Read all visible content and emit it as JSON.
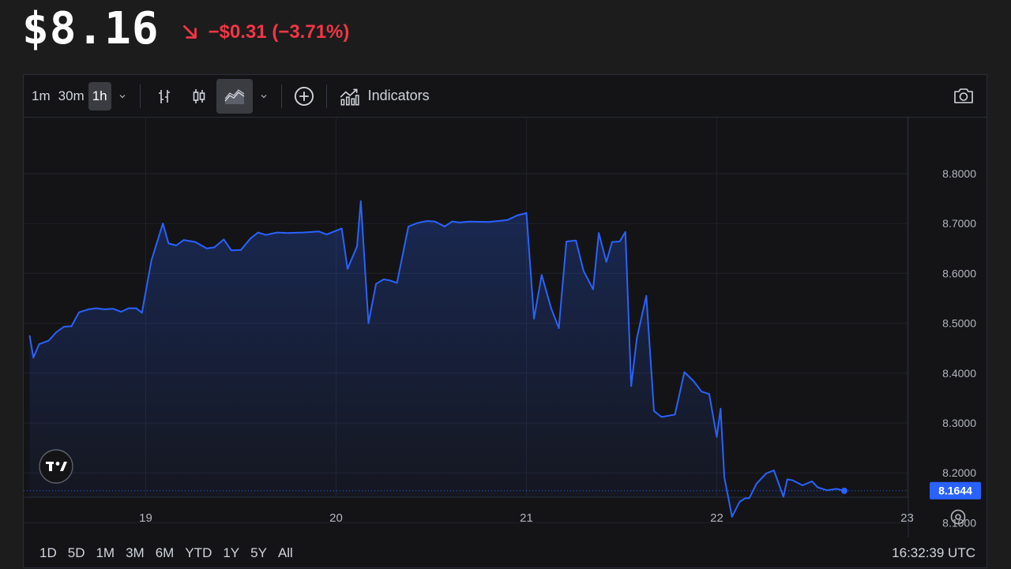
{
  "header": {
    "price": "$8.16",
    "change": "−$0.31 (−3.71%)",
    "change_color": "#f23645",
    "change_icon": "arrow-down-right-icon"
  },
  "toolbar": {
    "intervals": [
      {
        "label": "1m",
        "active": false
      },
      {
        "label": "30m",
        "active": false
      },
      {
        "label": "1h",
        "active": true
      }
    ],
    "interval_menu_icon": "chevron-down-icon",
    "chart_types": [
      {
        "icon": "bars-icon",
        "active": false
      },
      {
        "icon": "candles-icon",
        "active": false
      },
      {
        "icon": "area-icon",
        "active": true
      }
    ],
    "chart_type_menu_icon": "chevron-down-icon",
    "compare_icon": "plus-circle-icon",
    "indicators_icon": "indicators-icon",
    "indicators_label": "Indicators",
    "snapshot_icon": "camera-icon"
  },
  "chart_data": {
    "type": "area",
    "line_color": "#2962ff",
    "x": [
      18.39,
      18.41,
      18.44,
      18.49,
      18.53,
      18.57,
      18.61,
      18.65,
      18.7,
      18.74,
      18.78,
      18.83,
      18.87,
      18.91,
      18.95,
      18.98,
      19.03,
      19.09,
      19.12,
      19.16,
      19.2,
      19.26,
      19.32,
      19.36,
      19.41,
      19.45,
      19.5,
      19.55,
      19.59,
      19.63,
      19.69,
      19.75,
      19.83,
      19.91,
      19.95,
      20.01,
      20.03,
      20.06,
      20.11,
      20.13,
      20.17,
      20.21,
      20.25,
      20.28,
      20.32,
      20.38,
      20.42,
      20.45,
      20.48,
      20.52,
      20.57,
      20.61,
      20.65,
      20.7,
      20.8,
      20.9,
      20.95,
      21.0,
      21.04,
      21.08,
      21.13,
      21.17,
      21.21,
      21.26,
      21.3,
      21.35,
      21.38,
      21.42,
      21.45,
      21.49,
      21.52,
      21.55,
      21.58,
      21.63,
      21.67,
      21.71,
      21.78,
      21.83,
      21.88,
      21.92,
      21.96,
      22.0,
      22.02,
      22.04,
      22.08,
      22.12,
      22.15,
      22.17,
      22.21,
      22.26,
      22.3,
      22.35,
      22.37,
      22.4,
      22.45,
      22.5,
      22.53,
      22.58,
      22.63,
      22.67
    ],
    "y": [
      8.475,
      8.431,
      8.458,
      8.465,
      8.482,
      8.493,
      8.494,
      8.522,
      8.528,
      8.53,
      8.528,
      8.529,
      8.523,
      8.53,
      8.53,
      8.521,
      8.626,
      8.7,
      8.66,
      8.656,
      8.667,
      8.663,
      8.65,
      8.652,
      8.668,
      8.646,
      8.647,
      8.67,
      8.682,
      8.677,
      8.682,
      8.681,
      8.682,
      8.684,
      8.678,
      8.687,
      8.69,
      8.609,
      8.654,
      8.745,
      8.5,
      8.579,
      8.588,
      8.586,
      8.581,
      8.694,
      8.7,
      8.703,
      8.705,
      8.704,
      8.694,
      8.704,
      8.702,
      8.704,
      8.703,
      8.707,
      8.716,
      8.721,
      8.509,
      8.597,
      8.53,
      8.49,
      8.664,
      8.666,
      8.605,
      8.568,
      8.681,
      8.623,
      8.663,
      8.664,
      8.683,
      8.374,
      8.47,
      8.555,
      8.324,
      8.312,
      8.317,
      8.402,
      8.383,
      8.363,
      8.358,
      8.272,
      8.329,
      8.191,
      8.112,
      8.142,
      8.149,
      8.149,
      8.179,
      8.199,
      8.205,
      8.152,
      8.187,
      8.185,
      8.175,
      8.183,
      8.171,
      8.165,
      8.168,
      8.164
    ],
    "x_ticks": [
      {
        "value": 19,
        "label": "19"
      },
      {
        "value": 20,
        "label": "20"
      },
      {
        "value": 21,
        "label": "21"
      },
      {
        "value": 22,
        "label": "22"
      },
      {
        "value": 23,
        "label": "23"
      }
    ],
    "y_ticks": [
      {
        "value": 8.8,
        "label": "8.8000"
      },
      {
        "value": 8.7,
        "label": "8.7000"
      },
      {
        "value": 8.6,
        "label": "8.6000"
      },
      {
        "value": 8.5,
        "label": "8.5000"
      },
      {
        "value": 8.4,
        "label": "8.4000"
      },
      {
        "value": 8.3,
        "label": "8.3000"
      },
      {
        "value": 8.2,
        "label": "8.2000"
      },
      {
        "value": 8.1,
        "label": "8.1000"
      }
    ],
    "last_value": 8.1644,
    "last_value_label": "8.1644",
    "grid": true,
    "price_scale": "right"
  },
  "chart_overlay": {
    "logo_icon": "tradingview-logo-icon",
    "scale_settings_icon": "settings-circle-icon"
  },
  "bottom_bar": {
    "ranges": [
      "1D",
      "5D",
      "1M",
      "3M",
      "6M",
      "YTD",
      "1Y",
      "5Y",
      "All"
    ],
    "time": "16:32:39 UTC"
  }
}
